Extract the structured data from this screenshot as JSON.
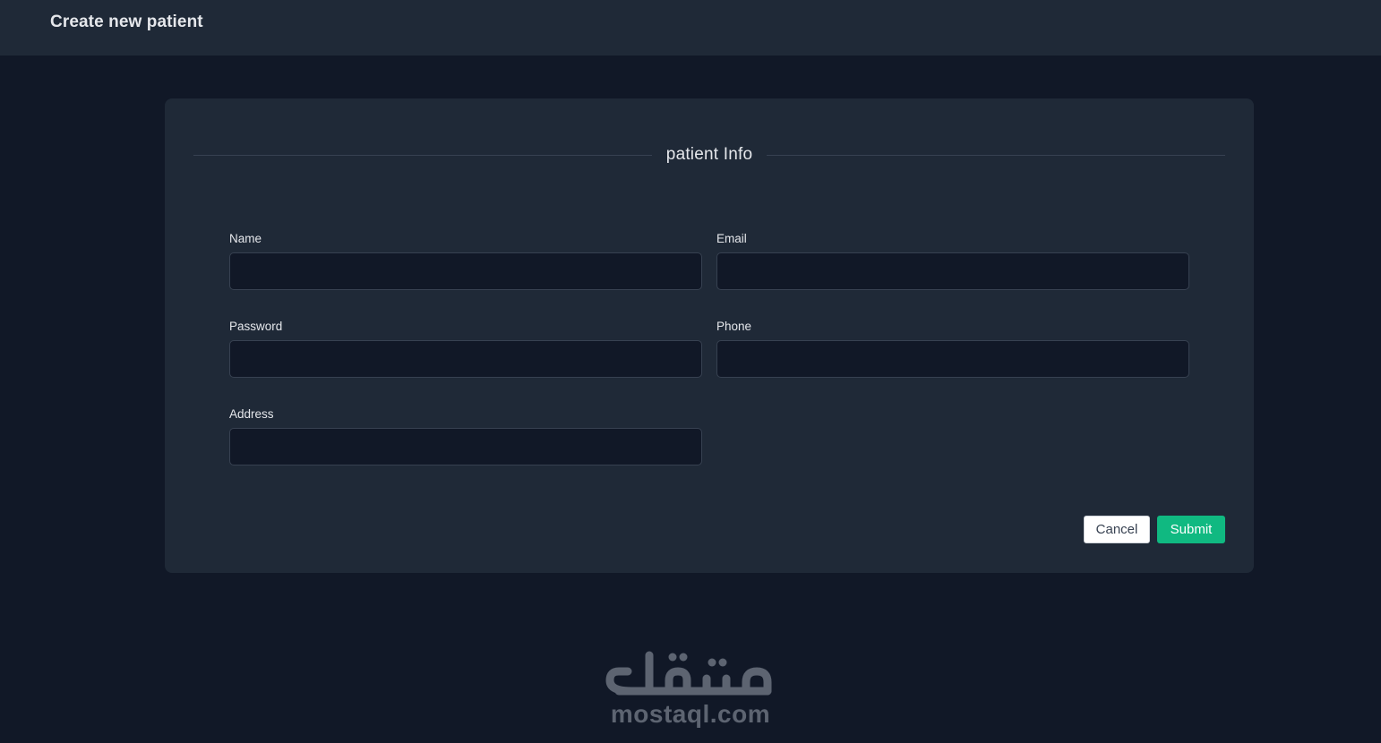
{
  "header": {
    "title": "Create new patient"
  },
  "form": {
    "section_title": "patient Info",
    "fields": {
      "name": {
        "label": "Name",
        "value": "",
        "placeholder": ""
      },
      "email": {
        "label": "Email",
        "value": "",
        "placeholder": ""
      },
      "password": {
        "label": "Password",
        "value": "",
        "placeholder": ""
      },
      "phone": {
        "label": "Phone",
        "value": "",
        "placeholder": ""
      },
      "address": {
        "label": "Address",
        "value": "",
        "placeholder": ""
      }
    },
    "actions": {
      "cancel_label": "Cancel",
      "submit_label": "Submit"
    }
  },
  "watermark": {
    "text": "mostaql.com",
    "logo": "مستقل"
  },
  "colors": {
    "background": "#111827",
    "panel": "#1f2937",
    "input": "#111827",
    "accent": "#10b981",
    "text": "#e5e7eb"
  }
}
